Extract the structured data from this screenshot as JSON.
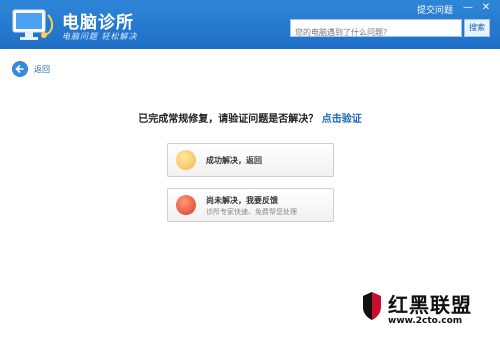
{
  "header": {
    "title": "电脑诊所",
    "subtitle": "电脑问题 轻松解决",
    "feedback_link": "提交问题",
    "search_placeholder": "您的电脑遇到了什么问题？",
    "search_button": "搜索"
  },
  "nav": {
    "back_label": "返回"
  },
  "main": {
    "prompt": "已完成常规修复，请验证问题是否解决？",
    "verify_link": "点击验证",
    "options": [
      {
        "title": "成功解决，返回",
        "subtitle": ""
      },
      {
        "title": "尚未解决，我要反馈",
        "subtitle": "诊所专家快速、免费帮您处理"
      }
    ]
  },
  "watermark": {
    "brand": "红黑联盟",
    "url": "www.2cto.com"
  },
  "colors": {
    "header": "#2f86d8",
    "link": "#1a6bbd"
  }
}
